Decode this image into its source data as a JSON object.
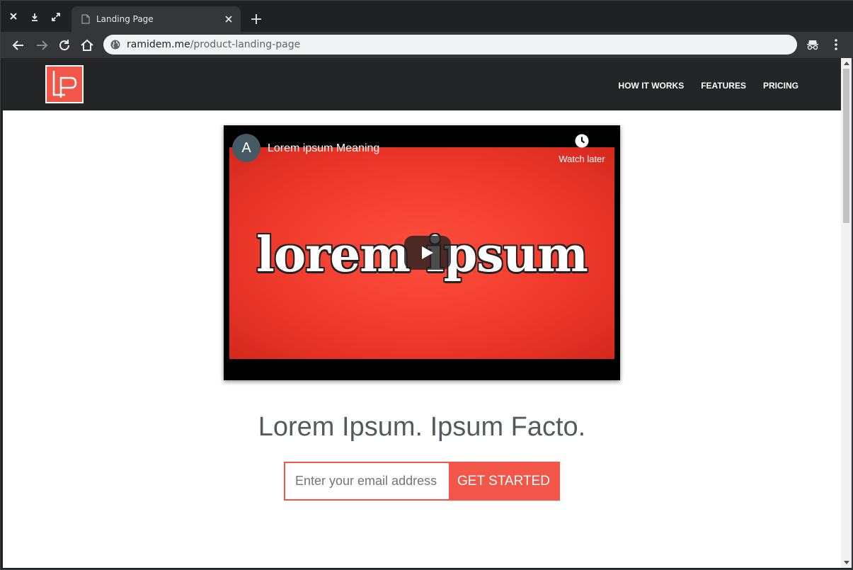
{
  "browser": {
    "tab_title": "Landing Page",
    "url_host": "ramidem.me",
    "url_path": "/product-landing-page"
  },
  "site": {
    "logo_alt": "LP",
    "nav": [
      "HOW IT WORKS",
      "FEATURES",
      "PRICING"
    ],
    "brand_color": "#f25648",
    "header_bg": "#242527"
  },
  "video": {
    "channel_initial": "A",
    "title": "Lorem ipsum Meaning",
    "watch_later": "Watch later",
    "thumbnail_text": "lorem ipsum"
  },
  "hero": {
    "headline": "Lorem Ipsum. Ipsum Facto.",
    "email_placeholder": "Enter your email address",
    "cta_label": "GET STARTED"
  },
  "icons": {
    "close": "close-icon",
    "download": "download-icon",
    "fullscreen": "expand-icon",
    "page": "page-icon",
    "new_tab": "plus-icon",
    "back": "back-arrow-icon",
    "forward": "forward-arrow-icon",
    "reload": "reload-icon",
    "home": "home-icon",
    "site_info": "globe-icon",
    "incognito": "incognito-icon",
    "menu": "kebab-menu-icon",
    "play": "play-icon",
    "clock": "clock-icon"
  }
}
